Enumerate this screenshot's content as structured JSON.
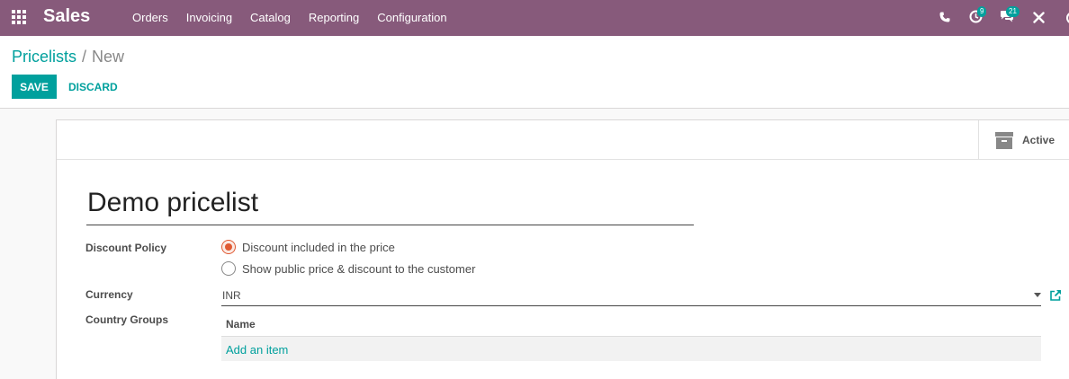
{
  "navbar": {
    "app_name": "Sales",
    "menu": [
      {
        "label": "Orders"
      },
      {
        "label": "Invoicing"
      },
      {
        "label": "Catalog"
      },
      {
        "label": "Reporting"
      },
      {
        "label": "Configuration"
      }
    ],
    "activity_count": "9",
    "messages_count": "21",
    "icons": [
      "apps-icon",
      "phone-icon",
      "clock-icon",
      "chat-icon",
      "tools-icon"
    ]
  },
  "breadcrumb": {
    "parent": "Pricelists",
    "separator": "/",
    "current": "New"
  },
  "actions": {
    "save": "SAVE",
    "discard": "DISCARD"
  },
  "form": {
    "active_label": "Active",
    "name": "Demo pricelist",
    "discount_policy": {
      "label": "Discount Policy",
      "options": [
        {
          "label": "Discount included in the price",
          "selected": true
        },
        {
          "label": "Show public price & discount to the customer",
          "selected": false
        }
      ]
    },
    "currency": {
      "label": "Currency",
      "value": "INR"
    },
    "country_groups": {
      "label": "Country Groups",
      "column": "Name",
      "add_item": "Add an item"
    }
  },
  "colors": {
    "navbar": "#875a7b",
    "accent": "#00a09d",
    "radio_checked": "#e05a33"
  }
}
